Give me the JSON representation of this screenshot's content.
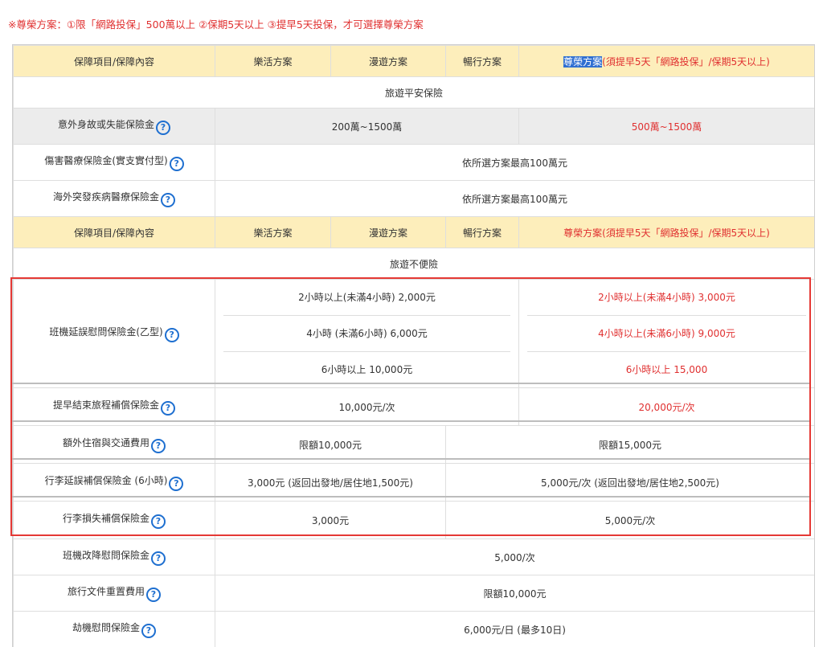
{
  "notice": "※尊榮方案：①限「網路投保」500萬以上 ②保期5天以上 ③提早5天投保，才可選擇尊榮方案",
  "header": {
    "item": "保障項目/保障內容",
    "plan1": "樂活方案",
    "plan2": "漫遊方案",
    "plan3": "暢行方案",
    "premium_name": "尊榮方案",
    "premium_note": "(須提早5天「網路投保」/保期5天以上)",
    "premium_full": "尊榮方案(須提早5天「網路投保」/保期5天以上)"
  },
  "section1": "旅遊平安保險",
  "rows1": [
    {
      "label": "意外身故或失能保險金",
      "value": "200萬~1500萬",
      "premium": "500萬~1500萬"
    },
    {
      "label": "傷害醫療保險金(實支實付型)",
      "value": "依所選方案最高100萬元"
    },
    {
      "label": "海外突發疾病醫療保險金",
      "value": "依所選方案最高100萬元"
    }
  ],
  "section2": "旅遊不便險",
  "flight_delay": {
    "label": "班機延誤慰問保險金(乙型)",
    "standard": [
      "2小時以上(未滿4小時) 2,000元",
      "4小時 (未滿6小時) 6,000元",
      "6小時以上 10,000元"
    ],
    "premium": [
      "2小時以上(未滿4小時) 3,000元",
      "4小時以上(未滿6小時) 9,000元",
      "6小時以上 15,000"
    ]
  },
  "early_end": {
    "label": "提早結束旅程補償保險金",
    "standard": "10,000元/次",
    "premium": "20,000元/次"
  },
  "extra_lodging": {
    "label": "額外住宿與交通費用",
    "standard": "限額10,000元",
    "premium": "限額15,000元"
  },
  "baggage_delay": {
    "label": "行李延誤補償保險金 (6小時)",
    "standard": "3,000元 (返回出發地/居住地1,500元)",
    "premium": "5,000元/次 (返回出發地/居住地2,500元)"
  },
  "baggage_loss": {
    "label": "行李損失補償保險金",
    "standard": "3,000元",
    "premium": "5,000元/次"
  },
  "rows3": [
    {
      "label": "班機改降慰問保險金",
      "value": "5,000/次"
    },
    {
      "label": "旅行文件重置費用",
      "value": "限額10,000元"
    },
    {
      "label": "劫機慰問保險金",
      "value": "6,000元/日 (最多10日)"
    }
  ],
  "help_icon_glyph": "?",
  "colors": {
    "accent_red": "#e03030",
    "header_bg": "#fdeebb",
    "help_blue": "#1e6fd0",
    "highlight_box": "#e53935"
  }
}
